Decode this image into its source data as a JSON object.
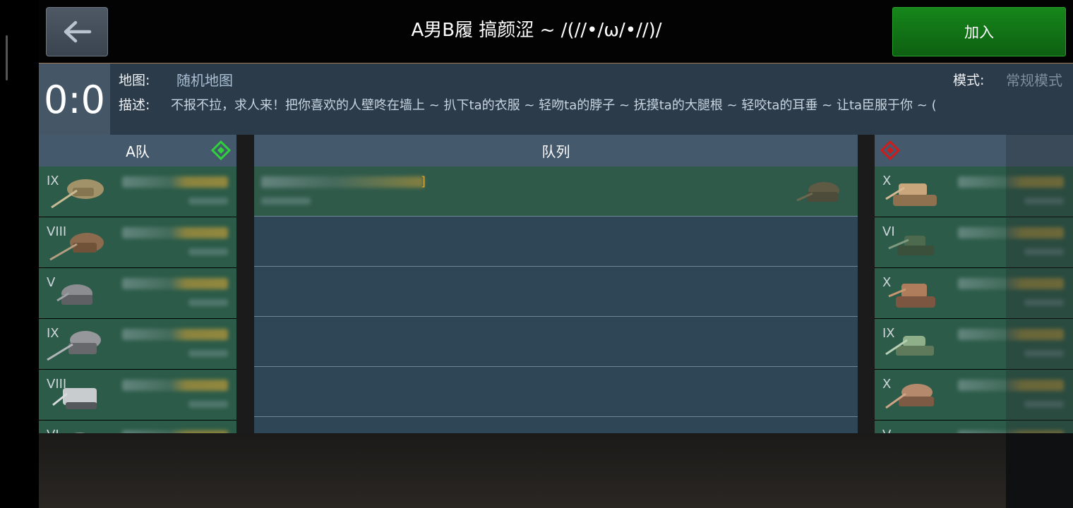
{
  "header": {
    "title": "A男B履 搞颜涩 ~ /(//•/ω/•//)/",
    "back_label": "←",
    "join_label": "加入"
  },
  "info": {
    "score": "0:0",
    "map_label": "地图:",
    "map_value": "随机地图",
    "mode_label": "模式:",
    "mode_value": "常规模式",
    "desc_label": "描述:",
    "desc_value": "不报不拉，求人来！把你喜欢的人壁咚在墙上 ~ 扒下ta的衣服 ~ 轻吻ta的脖子 ~ 抚摸ta的大腿根 ~ 轻咬ta的耳垂 ~ 让ta臣服于你 ~ ("
  },
  "team_a": {
    "label": "A队",
    "icon_color": "#2fd23a",
    "rows": [
      {
        "tier": "IX"
      },
      {
        "tier": "VIII"
      },
      {
        "tier": "V"
      },
      {
        "tier": "IX"
      },
      {
        "tier": "VIII"
      },
      {
        "tier": "VI"
      }
    ]
  },
  "queue": {
    "label": "队列",
    "bracket": "]"
  },
  "team_b": {
    "icon_color": "#d11a1a",
    "rows": [
      {
        "tier": "X"
      },
      {
        "tier": "VI"
      },
      {
        "tier": "X"
      },
      {
        "tier": "IX"
      },
      {
        "tier": "X"
      },
      {
        "tier": "V"
      }
    ]
  }
}
